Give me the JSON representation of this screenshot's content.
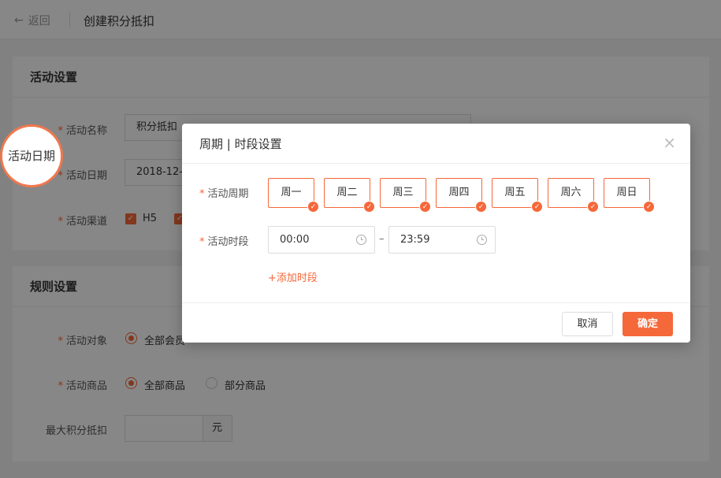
{
  "header": {
    "back_label": "返回",
    "title": "创建积分抵扣"
  },
  "activity": {
    "section_title": "活动设置",
    "name": {
      "label": "活动名称",
      "value": "积分抵扣"
    },
    "date": {
      "label": "活动日期",
      "value": "2018-12-"
    },
    "channel": {
      "label": "活动渠道",
      "option1": "H5"
    }
  },
  "rules": {
    "section_title": "规则设置",
    "target": {
      "label": "活动对象",
      "option1": "全部会员"
    },
    "goods": {
      "label": "活动商品",
      "option1": "全部商品",
      "option2": "部分商品"
    },
    "max_deduct": {
      "label": "最大积分抵扣",
      "unit": "元"
    }
  },
  "modal": {
    "title": "周期 | 时段设置",
    "close_glyph": "×",
    "cycle_label": "活动周期",
    "days": [
      "周一",
      "周二",
      "周三",
      "周四",
      "周五",
      "周六",
      "周日"
    ],
    "slot_label": "活动时段",
    "start_time": "00:00",
    "separator": "–",
    "end_time": "23:59",
    "add_slot": "+添加时段",
    "cancel": "取消",
    "confirm": "确定"
  },
  "callout": "活动日期",
  "colors": {
    "accent": "#f5683a"
  }
}
